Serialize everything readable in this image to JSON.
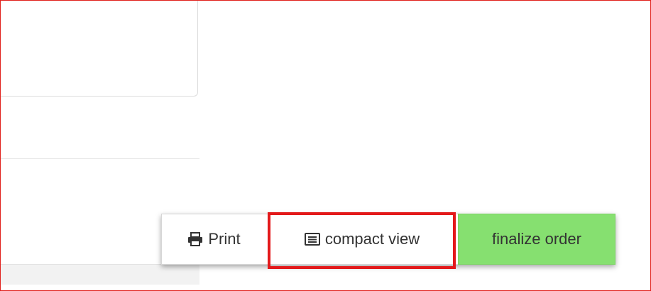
{
  "toolbar": {
    "print_label": "Print",
    "print_icon": "printer-icon",
    "compact_label": "compact view",
    "compact_icon": "list-view-icon",
    "finalize_label": "finalize order"
  },
  "colors": {
    "finalize_bg": "#86e070",
    "highlight": "#e3191b",
    "frame": "#e0201c"
  }
}
